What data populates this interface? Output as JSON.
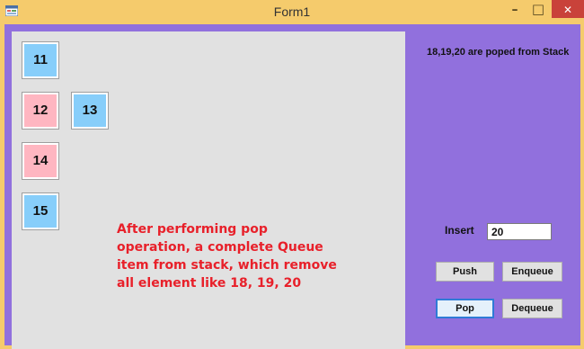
{
  "window": {
    "title": "Form1",
    "minimize_glyph": "–",
    "maximize_glyph": "□",
    "close_glyph": "✕",
    "accent_color": "#f5cb6c",
    "client_color": "#9170dd"
  },
  "stack_boxes": [
    {
      "value": "11",
      "color": "#87cefa"
    },
    {
      "value": "12",
      "color": "#ffb6c1"
    },
    {
      "value": "13",
      "color": "#87cefa"
    },
    {
      "value": "14",
      "color": "#ffb6c1"
    },
    {
      "value": "15",
      "color": "#87cefa"
    }
  ],
  "note": {
    "line1": "After performing pop",
    "line2": "operation, a complete Queue",
    "line3": "item from stack, which remove",
    "line4": "all element like 18, 19, 20",
    "color": "#e8202a"
  },
  "status_text": "18,19,20 are poped from Stack",
  "insert": {
    "label": "Insert",
    "value": "20"
  },
  "buttons": {
    "push": "Push",
    "enqueue": "Enqueue",
    "pop": "Pop",
    "dequeue": "Dequeue"
  },
  "icons": {
    "app": "winforms-app-icon",
    "minimize": "minimize-icon",
    "maximize": "maximize-icon",
    "close": "close-icon"
  }
}
